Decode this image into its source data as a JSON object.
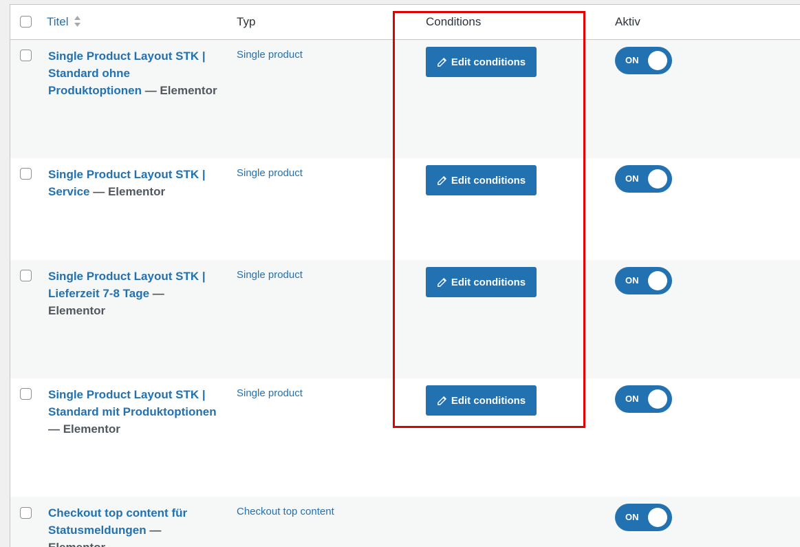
{
  "columns": {
    "title": "Titel",
    "typ": "Typ",
    "conditions": "Conditions",
    "aktiv": "Aktiv"
  },
  "rows": [
    {
      "title": "Single Product Layout STK | Standard ohne Produktoptionen",
      "suffix": " — Elementor",
      "typ": "Single product",
      "button": "Edit conditions",
      "toggle": "ON"
    },
    {
      "title": "Single Product Layout STK | Service",
      "suffix": " — Elementor",
      "typ": "Single product",
      "button": "Edit conditions",
      "toggle": "ON"
    },
    {
      "title": "Single Product Layout STK | Lieferzeit 7-8 Tage",
      "suffix": " — Elementor",
      "typ": "Single product",
      "button": "Edit conditions",
      "toggle": "ON"
    },
    {
      "title": "Single Product Layout STK | Standard mit Produktoptionen",
      "suffix": " — Elementor",
      "typ": "Single product",
      "button": "Edit conditions",
      "toggle": "ON"
    },
    {
      "title": "Checkout top content für Statusmeldungen",
      "suffix": " — Elementor",
      "typ": "Checkout top content",
      "button": "",
      "toggle": "ON"
    }
  ],
  "colors": {
    "accent": "#2271b1",
    "highlight": "#e00000"
  }
}
